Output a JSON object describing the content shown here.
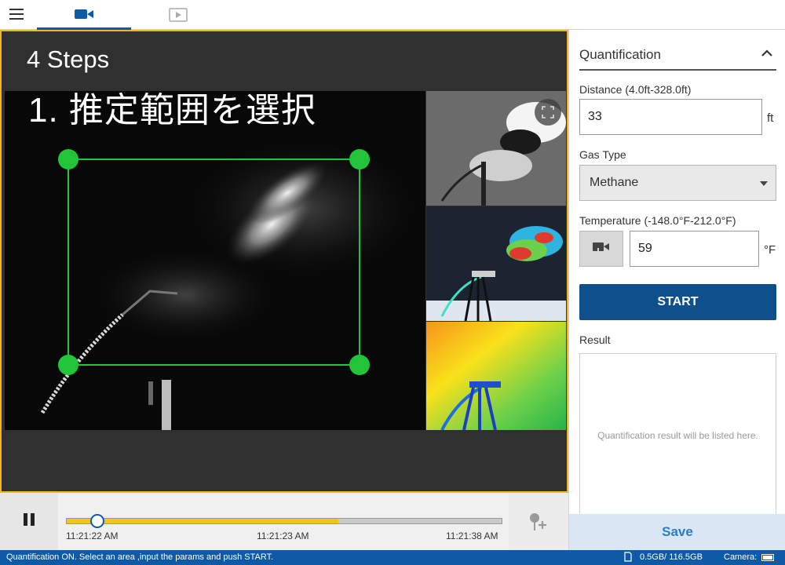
{
  "tabs": [
    {
      "icon": "video-camera-icon",
      "active": true
    },
    {
      "icon": "play-video-icon",
      "active": false
    }
  ],
  "overlay": {
    "steps": "4 Steps",
    "step_title": "1. 推定範囲を選択"
  },
  "timeline": {
    "progress_fraction": 0.07,
    "loaded_fraction": 0.625,
    "labels": [
      "11:21:22 AM",
      "11:21:23 AM",
      "11:21:38 AM"
    ]
  },
  "panel": {
    "title": "Quantification",
    "distance": {
      "label": "Distance (4.0ft-328.0ft)",
      "value": "33",
      "unit": "ft"
    },
    "gas_type": {
      "label": "Gas Type",
      "value": "Methane"
    },
    "temperature": {
      "label": "Temperature (-148.0°F-212.0°F)",
      "value": "59",
      "unit": "°F"
    },
    "start_label": "START",
    "result_label": "Result",
    "result_placeholder": "Quantification result will be listed here.",
    "save_label": "Save"
  },
  "status": {
    "message": "Quantification ON. Select an area ,input the params and push START.",
    "storage": "0.5GB/ 116.5GB",
    "camera_label": "Camera:"
  },
  "colors": {
    "accent": "#0e5aa7",
    "roi": "#22c43a",
    "frame": "#f2b51c",
    "start": "#0e4f8c"
  }
}
